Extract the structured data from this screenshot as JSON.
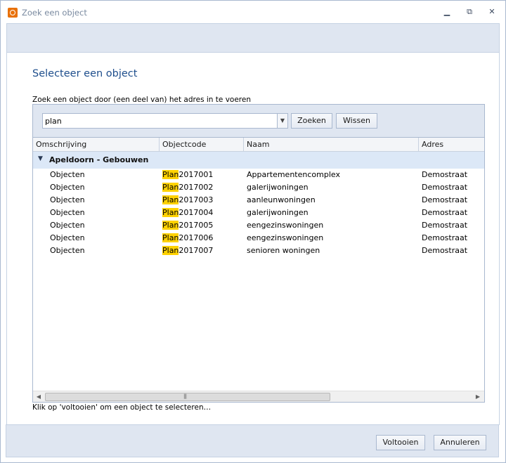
{
  "window": {
    "title": "Zoek een object",
    "minimize_glyph": "▁",
    "maximize_glyph": "⧉",
    "close_glyph": "✕"
  },
  "page": {
    "heading": "Selecteer een object",
    "instruction": "Zoek een object door (een deel van) het adres in te voeren"
  },
  "search": {
    "value": "plan",
    "search_label": "Zoeken",
    "clear_label": "Wissen"
  },
  "grid": {
    "columns": [
      "Omschrijving",
      "Objectcode",
      "Naam",
      "Adres"
    ],
    "group_label": "Apeldoorn - Gebouwen",
    "rows": [
      {
        "omschrijving": "Objecten",
        "code_match": "Plan",
        "code_rest": "2017001",
        "naam": "Appartementencomplex",
        "adres": "Demostraat"
      },
      {
        "omschrijving": "Objecten",
        "code_match": "Plan",
        "code_rest": "2017002",
        "naam": "galerijwoningen",
        "adres": "Demostraat"
      },
      {
        "omschrijving": "Objecten",
        "code_match": "Plan",
        "code_rest": "2017003",
        "naam": "aanleunwoningen",
        "adres": "Demostraat"
      },
      {
        "omschrijving": "Objecten",
        "code_match": "Plan",
        "code_rest": "2017004",
        "naam": "galerijwoningen",
        "adres": "Demostraat"
      },
      {
        "omschrijving": "Objecten",
        "code_match": "Plan",
        "code_rest": "2017005",
        "naam": "eengezinswoningen",
        "adres": "Demostraat"
      },
      {
        "omschrijving": "Objecten",
        "code_match": "Plan",
        "code_rest": "2017006",
        "naam": "eengezinswoningen",
        "adres": "Demostraat"
      },
      {
        "omschrijving": "Objecten",
        "code_match": "Plan",
        "code_rest": "2017007",
        "naam": "senioren woningen",
        "adres": "Demostraat"
      }
    ]
  },
  "status_text": "Klik op 'voltooien' om een object te selecteren…",
  "footer": {
    "finish_label": "Voltooien",
    "cancel_label": "Annuleren"
  },
  "colors": {
    "accent": "#1e4e8c",
    "panel": "#dfe6f1",
    "group_row": "#dce8f7",
    "highlight": "#ffd200"
  },
  "icons": {
    "app": "app-logo-icon",
    "dropdown": "chevron-down-icon",
    "group_toggle": "chevron-down-icon",
    "scroll_left": "arrow-left-icon",
    "scroll_right": "arrow-right-icon"
  }
}
